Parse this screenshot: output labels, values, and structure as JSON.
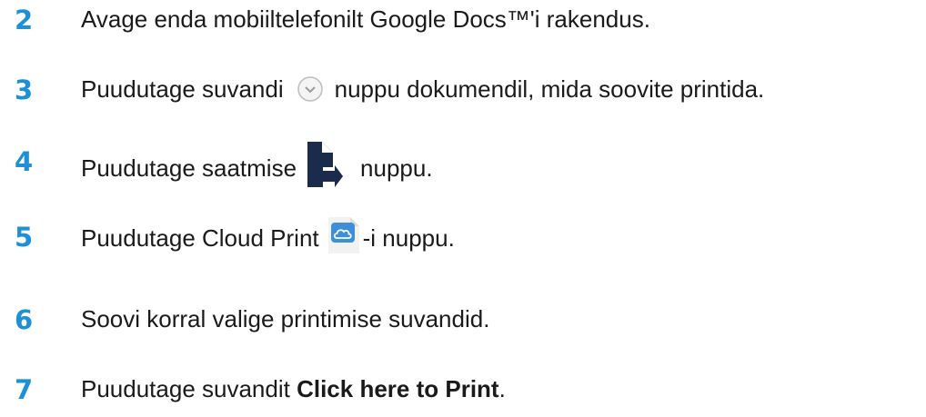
{
  "steps": [
    {
      "number": "2",
      "text": "Avage enda mobiiltelefonilt Google Docs™'i rakendus."
    },
    {
      "number": "3",
      "before": "Puudutage suvandi",
      "icon": "chevron-down-circle-icon",
      "after": "nuppu dokumendil, mida soovite printida."
    },
    {
      "number": "4",
      "before": "Puudutage saatmise",
      "icon": "send-document-icon",
      "after": "nuppu."
    },
    {
      "number": "5",
      "before": "Puudutage Cloud Print",
      "icon": "cloud-print-icon",
      "after": "-i nuppu."
    },
    {
      "number": "6",
      "text": "Soovi korral valige printimise suvandid."
    },
    {
      "number": "7",
      "before": "Puudutage suvandit ",
      "bold": "Click here to Print",
      "after": "."
    }
  ],
  "colors": {
    "number": "#1c91d8",
    "text": "#1a1a1a",
    "send_icon": "#1b2b4b",
    "cloud_icon": "#3c8fd8"
  }
}
